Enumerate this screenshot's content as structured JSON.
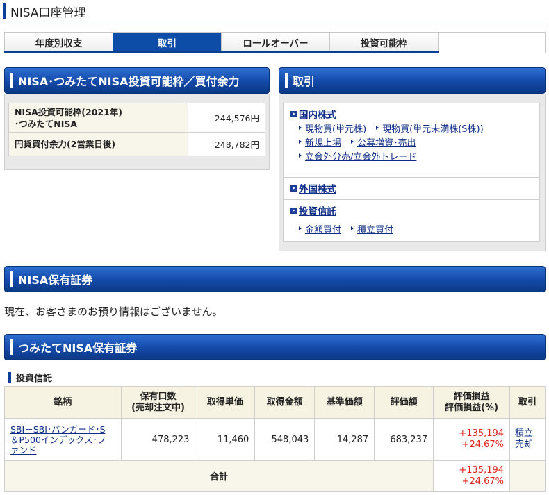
{
  "page": {
    "title": "NISA口座管理"
  },
  "tabs": [
    {
      "label": "年度別収支"
    },
    {
      "label": "取引"
    },
    {
      "label": "ロールオーバー"
    },
    {
      "label": "投資可能枠"
    }
  ],
  "nisa_capacity": {
    "header": "NISA･つみたてNISA投資可能枠／買付余力",
    "rows": [
      {
        "label_line1": "NISA投資可能枠(2021年)",
        "label_line2": "･つみたてNISA",
        "value": "244,576円"
      },
      {
        "label_line1": "円貨買付余力(2営業日後)",
        "value": "248,782円"
      }
    ]
  },
  "trade": {
    "header": "取引",
    "sections": [
      {
        "title": "国内株式",
        "links": [
          [
            "現物買(単元株)",
            "現物買(単元未満株(S株))"
          ],
          [
            "新規上場",
            "公募増資･売出"
          ],
          [
            "立会外分売/立会外トレード"
          ]
        ]
      },
      {
        "title": "外国株式",
        "links": []
      },
      {
        "title": "投資信託",
        "links": [
          [
            "金額買付",
            "積立買付"
          ]
        ]
      }
    ]
  },
  "nisa_holdings": {
    "header": "NISA保有証券",
    "message": "現在、お客さまのお預り情報はございません。"
  },
  "tsumitate_holdings": {
    "header": "つみたてNISA保有証券",
    "subtitle": "投資信託",
    "columns": {
      "name": "銘柄",
      "units_l1": "保有口数",
      "units_l2": "(売却注文中)",
      "unit_cost": "取得単価",
      "cost": "取得金額",
      "nav": "基準価額",
      "value": "評価額",
      "pl_l1": "評価損益",
      "pl_l2": "評価損益(%)",
      "trade": "取引"
    },
    "rows": [
      {
        "name_l1": "SBI－SBI･バンガード･S",
        "name_l2": "＆P500インデックス･フ",
        "name_l3": "ァンド",
        "units": "478,223",
        "unit_cost": "11,460",
        "cost": "548,043",
        "nav": "14,287",
        "value": "683,237",
        "pl": "+135,194",
        "pl_pct": "+24.67%",
        "action1": "積立",
        "action2": "売却"
      }
    ],
    "total": {
      "label": "合計",
      "pl": "+135,194",
      "pl_pct": "+24.67%"
    }
  },
  "colors": {
    "header_blue": "#1349a8",
    "accent_navy": "#0a3f9c",
    "gain_red": "#e2231a",
    "link_navy": "#0d2d86"
  }
}
